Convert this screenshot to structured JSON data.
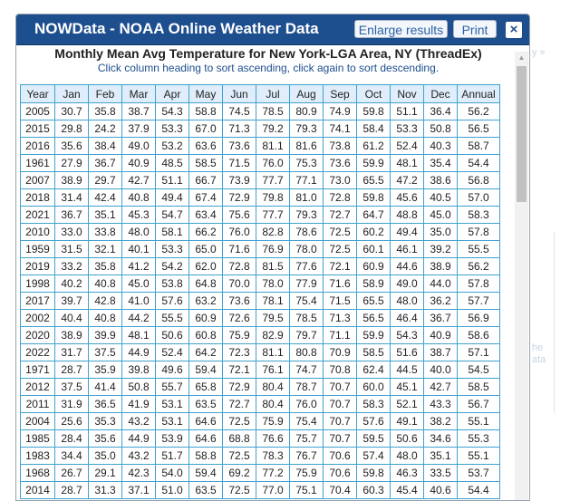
{
  "window": {
    "title": "NOWData - NOAA Online Weather Data",
    "enlarge_label": "Enlarge results",
    "print_label": "Print",
    "close_label": "×"
  },
  "report": {
    "heading": "Monthly Mean Avg Temperature for New York-LGA Area, NY (ThreadEx)",
    "subheading": "Click column heading to sort ascending, click again to sort descending."
  },
  "background": {
    "hint_top": "y »",
    "hint_side": "he\nata"
  },
  "table": {
    "headers": [
      "Year",
      "Jan",
      "Feb",
      "Mar",
      "Apr",
      "May",
      "Jun",
      "Jul",
      "Aug",
      "Sep",
      "Oct",
      "Nov",
      "Dec",
      "Annual"
    ],
    "rows": [
      [
        "2005",
        "30.7",
        "35.8",
        "38.7",
        "54.3",
        "58.8",
        "74.5",
        "78.5",
        "80.9",
        "74.9",
        "59.8",
        "51.1",
        "36.4",
        "56.2"
      ],
      [
        "2015",
        "29.8",
        "24.2",
        "37.9",
        "53.3",
        "67.0",
        "71.3",
        "79.2",
        "79.3",
        "74.1",
        "58.4",
        "53.3",
        "50.8",
        "56.5"
      ],
      [
        "2016",
        "35.6",
        "38.4",
        "49.0",
        "53.2",
        "63.6",
        "73.6",
        "81.1",
        "81.6",
        "73.8",
        "61.2",
        "52.4",
        "40.3",
        "58.7"
      ],
      [
        "1961",
        "27.9",
        "36.7",
        "40.9",
        "48.5",
        "58.5",
        "71.5",
        "76.0",
        "75.3",
        "73.6",
        "59.9",
        "48.1",
        "35.4",
        "54.4"
      ],
      [
        "2007",
        "38.9",
        "29.7",
        "42.7",
        "51.1",
        "66.7",
        "73.9",
        "77.7",
        "77.1",
        "73.0",
        "65.5",
        "47.2",
        "38.6",
        "56.8"
      ],
      [
        "2018",
        "31.4",
        "42.4",
        "40.8",
        "49.4",
        "67.4",
        "72.9",
        "79.8",
        "81.0",
        "72.8",
        "59.8",
        "45.6",
        "40.5",
        "57.0"
      ],
      [
        "2021",
        "36.7",
        "35.1",
        "45.3",
        "54.7",
        "63.4",
        "75.6",
        "77.7",
        "79.3",
        "72.7",
        "64.7",
        "48.8",
        "45.0",
        "58.3"
      ],
      [
        "2010",
        "33.0",
        "33.8",
        "48.0",
        "58.1",
        "66.2",
        "76.0",
        "82.8",
        "78.6",
        "72.5",
        "60.2",
        "49.4",
        "35.0",
        "57.8"
      ],
      [
        "1959",
        "31.5",
        "32.1",
        "40.1",
        "53.3",
        "65.0",
        "71.6",
        "76.9",
        "78.0",
        "72.5",
        "60.1",
        "46.1",
        "39.2",
        "55.5"
      ],
      [
        "2019",
        "33.2",
        "35.8",
        "41.2",
        "54.2",
        "62.0",
        "72.8",
        "81.5",
        "77.6",
        "72.1",
        "60.9",
        "44.6",
        "38.9",
        "56.2"
      ],
      [
        "1998",
        "40.2",
        "40.8",
        "45.0",
        "53.8",
        "64.8",
        "70.0",
        "78.0",
        "77.9",
        "71.6",
        "58.9",
        "49.0",
        "44.0",
        "57.8"
      ],
      [
        "2017",
        "39.7",
        "42.8",
        "41.0",
        "57.6",
        "63.2",
        "73.6",
        "78.1",
        "75.4",
        "71.5",
        "65.5",
        "48.0",
        "36.2",
        "57.7"
      ],
      [
        "2002",
        "40.4",
        "40.8",
        "44.2",
        "55.5",
        "60.9",
        "72.6",
        "79.5",
        "78.5",
        "71.3",
        "56.5",
        "46.4",
        "36.7",
        "56.9"
      ],
      [
        "2020",
        "38.9",
        "39.9",
        "48.1",
        "50.6",
        "60.8",
        "75.9",
        "82.9",
        "79.7",
        "71.1",
        "59.9",
        "54.3",
        "40.9",
        "58.6"
      ],
      [
        "2022",
        "31.7",
        "37.5",
        "44.9",
        "52.4",
        "64.2",
        "72.3",
        "81.1",
        "80.8",
        "70.9",
        "58.5",
        "51.6",
        "38.7",
        "57.1"
      ],
      [
        "1971",
        "28.7",
        "35.9",
        "39.8",
        "49.6",
        "59.4",
        "72.1",
        "76.1",
        "74.7",
        "70.8",
        "62.4",
        "44.5",
        "40.0",
        "54.5"
      ],
      [
        "2012",
        "37.5",
        "41.4",
        "50.8",
        "55.7",
        "65.8",
        "72.9",
        "80.4",
        "78.7",
        "70.7",
        "60.0",
        "45.1",
        "42.7",
        "58.5"
      ],
      [
        "2011",
        "31.9",
        "36.5",
        "41.9",
        "53.1",
        "63.5",
        "72.7",
        "80.4",
        "76.0",
        "70.7",
        "58.3",
        "52.1",
        "43.3",
        "56.7"
      ],
      [
        "2004",
        "25.6",
        "35.3",
        "43.2",
        "53.1",
        "64.6",
        "72.5",
        "75.9",
        "75.4",
        "70.7",
        "57.6",
        "49.1",
        "38.2",
        "55.1"
      ],
      [
        "1985",
        "28.4",
        "35.6",
        "44.9",
        "53.9",
        "64.6",
        "68.8",
        "76.6",
        "75.7",
        "70.7",
        "59.5",
        "50.6",
        "34.6",
        "55.3"
      ],
      [
        "1983",
        "34.4",
        "35.0",
        "43.2",
        "51.7",
        "58.8",
        "72.5",
        "78.3",
        "76.7",
        "70.6",
        "57.4",
        "48.0",
        "35.1",
        "55.1"
      ],
      [
        "1968",
        "26.7",
        "29.1",
        "42.3",
        "54.0",
        "59.4",
        "69.2",
        "77.2",
        "75.9",
        "70.6",
        "59.8",
        "46.3",
        "33.5",
        "53.7"
      ],
      [
        "2014",
        "28.7",
        "31.3",
        "37.1",
        "51.0",
        "63.5",
        "72.5",
        "77.0",
        "75.1",
        "70.4",
        "60.3",
        "45.4",
        "40.6",
        "54.4"
      ]
    ]
  },
  "colors": {
    "titlebar": "#1d4e8e",
    "table_border": "#3fa1d0",
    "header_bg": "#dfeefa",
    "subheading_text": "#1d4e8e"
  }
}
